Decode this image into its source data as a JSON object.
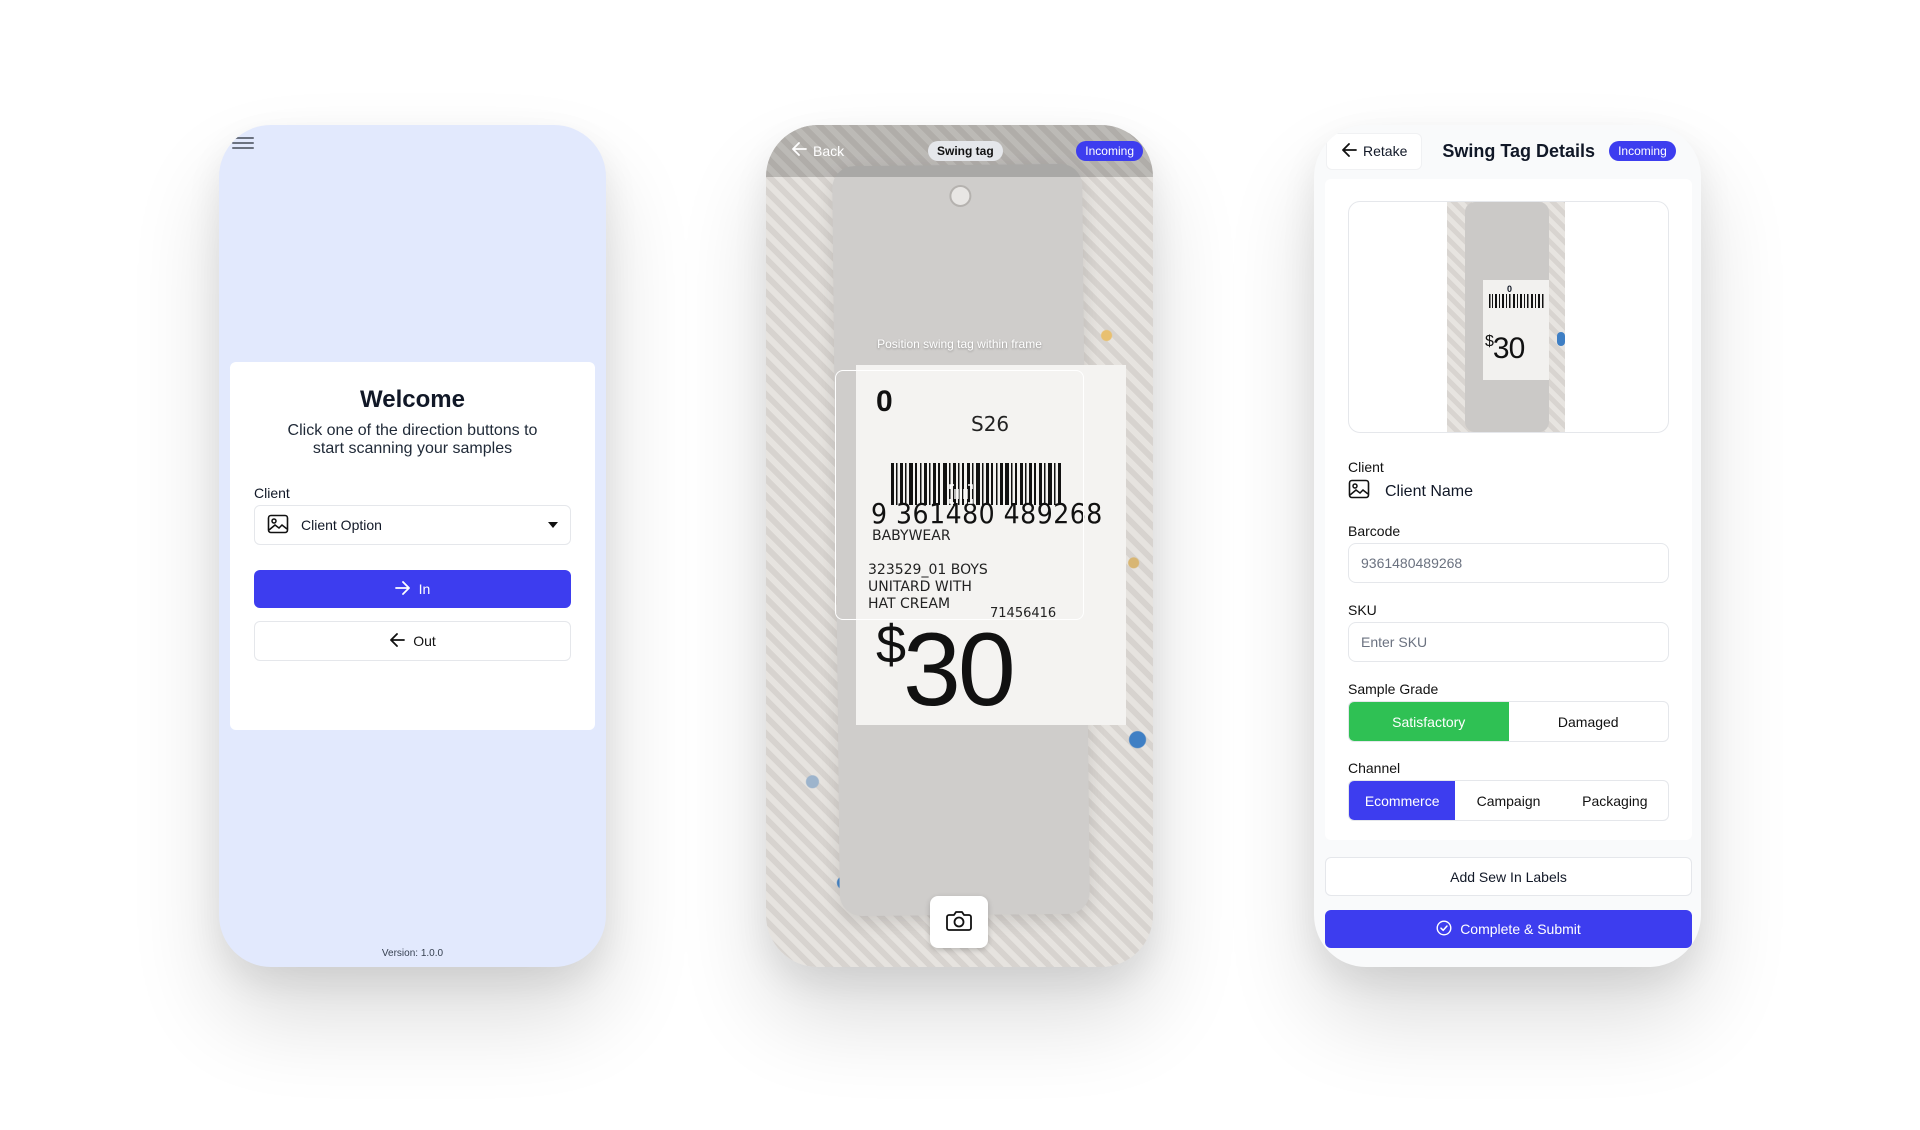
{
  "home": {
    "welcome_title": "Welcome",
    "welcome_subtitle": "Click one of the direction buttons to start scanning your samples",
    "client_label": "Client",
    "client_select_value": "Client Option",
    "in_button": "In",
    "out_button": "Out",
    "version": "Version: 1.0.0",
    "icons": {
      "menu": "hamburger-menu-icon",
      "image": "image-icon",
      "arrow_right": "arrow-right-icon",
      "arrow_left": "arrow-left-icon",
      "caret": "caret-down-icon"
    }
  },
  "camera": {
    "back_label": "Back",
    "mode_pill": "Swing tag",
    "direction_pill": "Incoming",
    "frame_hint": "Position swing tag within frame",
    "icons": {
      "back": "arrow-left-icon",
      "scan": "barcode-scan-icon",
      "shutter": "camera-icon"
    },
    "tag": {
      "grade_number": "0",
      "season": "S26",
      "barcode_number": "9 361480 489268",
      "department": "BABYWEAR",
      "style_line1": "323529_01 BOYS",
      "style_line2": "UNITARD WITH HAT CREAM",
      "code": "71456416",
      "price_symbol": "$",
      "price_value": "30"
    }
  },
  "details": {
    "retake_label": "Retake",
    "title": "Swing Tag Details",
    "direction_pill": "Incoming",
    "client_label": "Client",
    "client_value": "Client Name",
    "barcode_label": "Barcode",
    "barcode_value": "9361480489268",
    "sku_label": "SKU",
    "sku_placeholder": "Enter SKU",
    "grade_label": "Sample Grade",
    "grade_options": [
      "Satisfactory",
      "Damaged"
    ],
    "grade_selected": "Satisfactory",
    "channel_label": "Channel",
    "channel_options": [
      "Ecommerce",
      "Campaign",
      "Packaging"
    ],
    "channel_selected": "Ecommerce",
    "sew_in_button": "Add Sew In Labels",
    "submit_button": "Complete & Submit",
    "thumb": {
      "zero": "0",
      "price_symbol": "$",
      "price_value": "30"
    },
    "colors": {
      "primary": "#3d3def",
      "success": "#2fc154"
    }
  }
}
